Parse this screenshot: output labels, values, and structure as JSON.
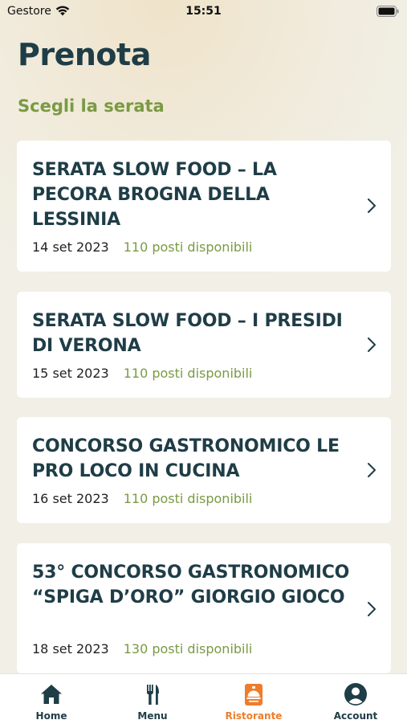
{
  "status_bar": {
    "carrier": "Gestore",
    "time": "15:51"
  },
  "page": {
    "title": "Prenota",
    "subtitle": "Scegli la serata"
  },
  "events": [
    {
      "title": "Serata Slow Food – La Pecora Brogna della Lessinia",
      "date": "14 set 2023",
      "seats": "110 posti disponibili"
    },
    {
      "title": "Serata Slow Food – I Presidi di Verona",
      "date": "15 set 2023",
      "seats": "110 posti disponibili"
    },
    {
      "title": "Concorso Gastronomico Le Pro Loco in Cucina",
      "date": "16 set 2023",
      "seats": "110 posti disponibili"
    },
    {
      "title": "53° Concorso Gastronomico “Spiga d’Oro” Giorgio Gioco",
      "date": "18 set 2023",
      "seats": "130 posti disponibili"
    }
  ],
  "tabbar": {
    "items": [
      {
        "label": "Home",
        "icon": "home-icon"
      },
      {
        "label": "Menu",
        "icon": "cutlery-icon"
      },
      {
        "label": "Ristorante",
        "icon": "restaurant-icon",
        "active": true
      },
      {
        "label": "Account",
        "icon": "account-icon"
      }
    ]
  },
  "colors": {
    "primary": "#1f3d47",
    "accent_green": "#7a9a43",
    "active_tab": "#ee7d2b",
    "background": "#f1efe6"
  }
}
